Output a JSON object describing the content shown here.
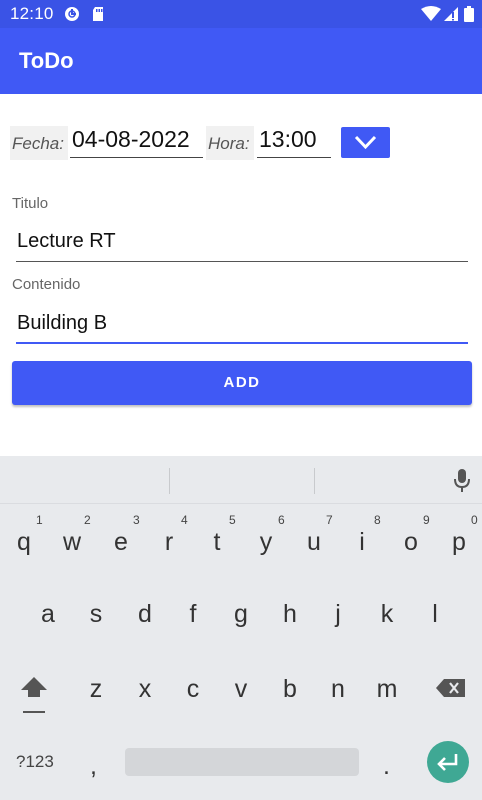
{
  "status_bar": {
    "time": "12:10",
    "left_icons": [
      "data-saver-icon",
      "sd-card-icon"
    ],
    "right_icons": [
      "wifi-icon",
      "signal-icon",
      "battery-icon"
    ]
  },
  "app_bar": {
    "title": "ToDo"
  },
  "datetime": {
    "fecha_label": "Fecha:",
    "fecha_value": "04-08-2022",
    "hora_label": "Hora:",
    "hora_value": "13:00",
    "dropdown_icon": "chevron-down-icon"
  },
  "form": {
    "titulo_label": "Titulo",
    "titulo_value": "Lecture RT",
    "contenido_label": "Contenido",
    "contenido_value": "Building B",
    "add_label": "ADD"
  },
  "keyboard": {
    "row1": [
      "q",
      "w",
      "e",
      "r",
      "t",
      "y",
      "u",
      "i",
      "o",
      "p"
    ],
    "row1_hints": [
      "1",
      "2",
      "3",
      "4",
      "5",
      "6",
      "7",
      "8",
      "9",
      "0"
    ],
    "row2": [
      "a",
      "s",
      "d",
      "f",
      "g",
      "h",
      "j",
      "k",
      "l"
    ],
    "row3": [
      "z",
      "x",
      "c",
      "v",
      "b",
      "n",
      "m"
    ],
    "symbols_label": "?123",
    "comma": ",",
    "period": ".",
    "icons": [
      "mic-icon",
      "shift-icon",
      "backspace-icon",
      "enter-icon"
    ]
  },
  "colors": {
    "primary": "#4059f5",
    "status_bar": "#3a53e6",
    "enter_key": "#3fa894",
    "keyboard_bg": "#e8eaed"
  }
}
